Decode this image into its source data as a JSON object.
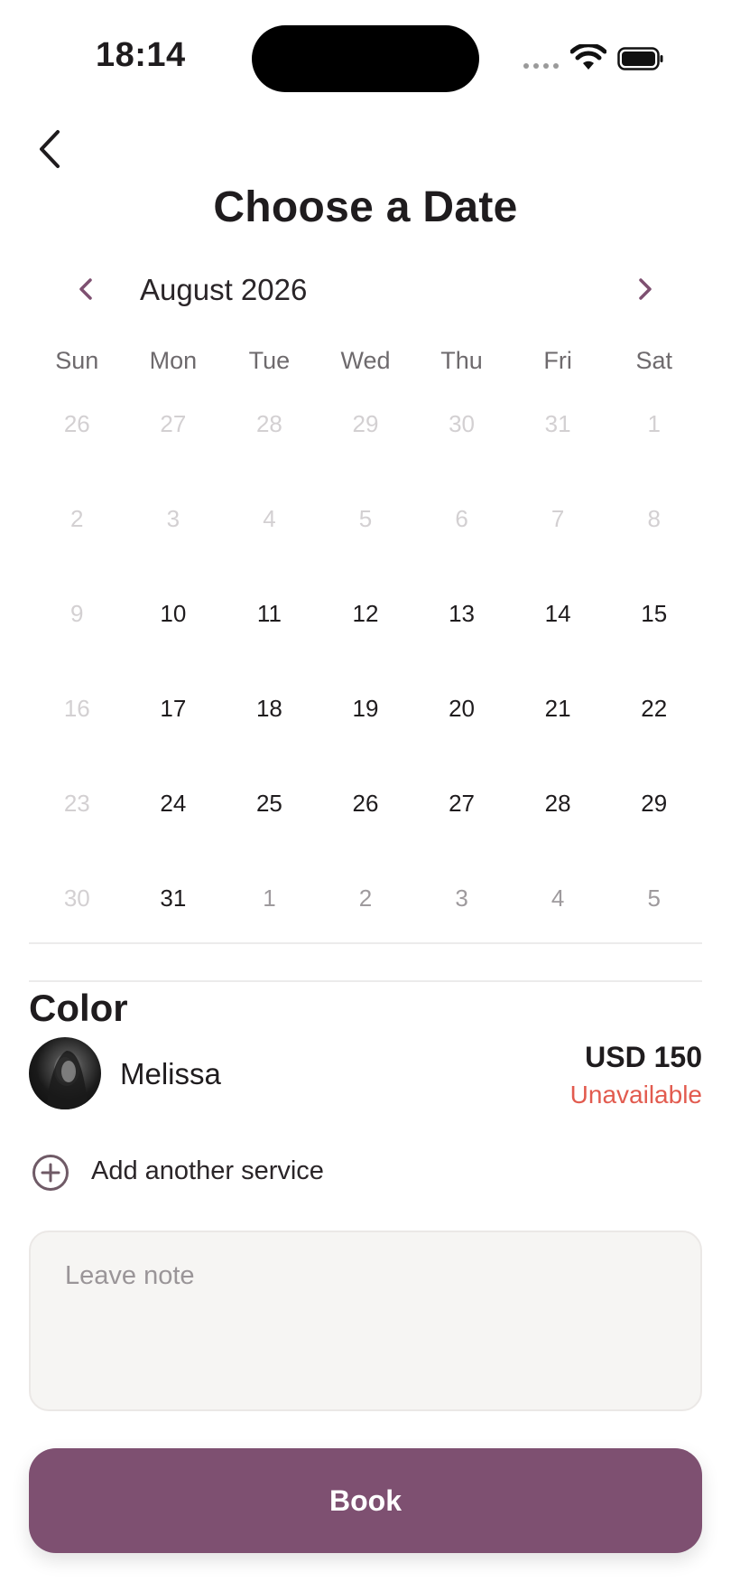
{
  "status_bar": {
    "time": "18:14"
  },
  "header": {
    "title": "Choose a Date"
  },
  "calendar": {
    "month_label": "August 2026",
    "weekdays": [
      "Sun",
      "Mon",
      "Tue",
      "Wed",
      "Thu",
      "Fri",
      "Sat"
    ],
    "days": [
      {
        "n": "26",
        "s": "muted"
      },
      {
        "n": "27",
        "s": "muted"
      },
      {
        "n": "28",
        "s": "muted"
      },
      {
        "n": "29",
        "s": "muted"
      },
      {
        "n": "30",
        "s": "muted"
      },
      {
        "n": "31",
        "s": "muted"
      },
      {
        "n": "1",
        "s": "muted"
      },
      {
        "n": "2",
        "s": "muted"
      },
      {
        "n": "3",
        "s": "muted"
      },
      {
        "n": "4",
        "s": "muted"
      },
      {
        "n": "5",
        "s": "muted"
      },
      {
        "n": "6",
        "s": "muted"
      },
      {
        "n": "7",
        "s": "muted"
      },
      {
        "n": "8",
        "s": "muted"
      },
      {
        "n": "9",
        "s": "muted"
      },
      {
        "n": "10",
        "s": "active"
      },
      {
        "n": "11",
        "s": "active"
      },
      {
        "n": "12",
        "s": "active"
      },
      {
        "n": "13",
        "s": "active"
      },
      {
        "n": "14",
        "s": "active"
      },
      {
        "n": "15",
        "s": "active"
      },
      {
        "n": "16",
        "s": "muted"
      },
      {
        "n": "17",
        "s": "active"
      },
      {
        "n": "18",
        "s": "active"
      },
      {
        "n": "19",
        "s": "active"
      },
      {
        "n": "20",
        "s": "active"
      },
      {
        "n": "21",
        "s": "active"
      },
      {
        "n": "22",
        "s": "active"
      },
      {
        "n": "23",
        "s": "muted"
      },
      {
        "n": "24",
        "s": "active"
      },
      {
        "n": "25",
        "s": "active"
      },
      {
        "n": "26",
        "s": "active"
      },
      {
        "n": "27",
        "s": "active"
      },
      {
        "n": "28",
        "s": "active"
      },
      {
        "n": "29",
        "s": "active"
      },
      {
        "n": "30",
        "s": "muted"
      },
      {
        "n": "31",
        "s": "active"
      },
      {
        "n": "1",
        "s": "nextm"
      },
      {
        "n": "2",
        "s": "nextm"
      },
      {
        "n": "3",
        "s": "nextm"
      },
      {
        "n": "4",
        "s": "nextm"
      },
      {
        "n": "5",
        "s": "nextm"
      }
    ]
  },
  "service": {
    "title": "Color",
    "stylist_name": "Melissa",
    "price": "USD 150",
    "availability": "Unavailable"
  },
  "add_service": {
    "label": "Add another service",
    "icon": "plus-circle-icon"
  },
  "note": {
    "placeholder": "Leave note"
  },
  "book_button": {
    "label": "Book"
  },
  "colors": {
    "accent": "#7e5071",
    "error": "#e25b4f",
    "chevron": "#7e5071"
  }
}
